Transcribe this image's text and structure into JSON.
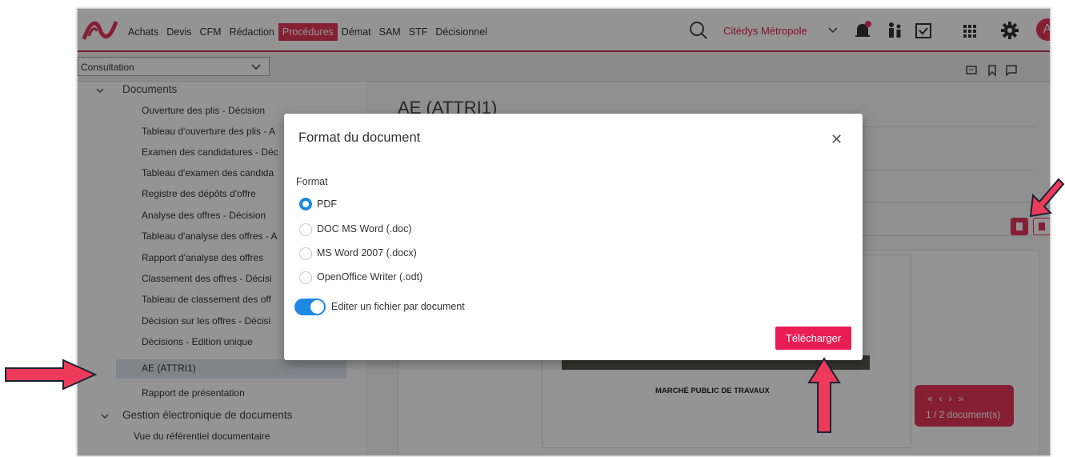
{
  "menu": [
    "Achats",
    "Devis",
    "CFM",
    "Rédaction",
    "Procédures",
    "Démat",
    "SAM",
    "STF",
    "Décisionnel"
  ],
  "menu_active": "Procédures",
  "organization": "Citédys Métropole",
  "avatar_initial": "A",
  "context_select": "Consultation",
  "sidebar": {
    "documents_group": "Documents",
    "items": [
      "Ouverture des plis - Décision",
      "Tableau d'ouverture des plis - A",
      "Examen des candidatures - Déc",
      "Tableau d'examen des candida",
      "Registre des dépôts d'offre",
      "Analyse des offres - Décision",
      "Tableau d'analyse des offres - A",
      "Rapport d'analyse des offres",
      "Classement des offres - Décisi",
      "Tableau de classement des off",
      "Décision sur les offres - Décisi",
      "Décisions - Edition unique",
      "AE (ATTRI1)",
      "Rapport de présentation"
    ],
    "selected": "AE (ATTRI1)",
    "ged_group": "Gestion électronique de documents",
    "ged_item": "Vue du référentiel documentaire"
  },
  "main": {
    "title": "AE (ATTRI1)",
    "doc_heading": "MARCHÉ PUBLIC DE TRAVAUX",
    "pager_count": "1 / 2 document(s)"
  },
  "modal": {
    "title": "Format du document",
    "format_label": "Format",
    "options": [
      "PDF",
      "DOC MS Word (.doc)",
      "MS Word 2007 (.docx)",
      "OpenOffice Writer (.odt)"
    ],
    "selected_option": "PDF",
    "toggle_label": "Editer un fichier par document",
    "toggle_on": true,
    "download_button": "Télécharger"
  },
  "colors": {
    "accent": "#e5365b",
    "toggle": "#1e88e5",
    "arrow": "#ee3a5a"
  }
}
